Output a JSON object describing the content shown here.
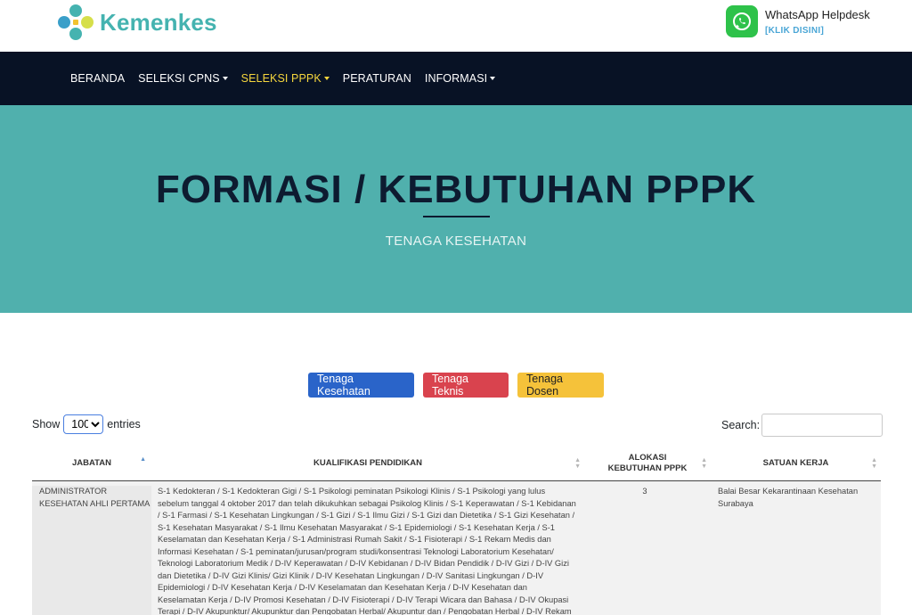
{
  "brand": {
    "name": "Kemenkes",
    "helpdesk_title": "WhatsApp Helpdesk",
    "helpdesk_link": "[KLIK DISINI]",
    "helpdesk_icon": "whatsapp-icon",
    "colors": {
      "brand": "#45b3b0",
      "whatsapp": "#2ec24a"
    }
  },
  "nav": {
    "items": [
      {
        "label": "BERANDA",
        "dropdown": false,
        "active": false
      },
      {
        "label": "SELEKSI CPNS",
        "dropdown": true,
        "active": false
      },
      {
        "label": "SELEKSI PPPK",
        "dropdown": true,
        "active": true
      },
      {
        "label": "PERATURAN",
        "dropdown": false,
        "active": false
      },
      {
        "label": "INFORMASI",
        "dropdown": true,
        "active": false
      }
    ],
    "colors": {
      "background": "#081225",
      "active": "#f5d63d"
    }
  },
  "hero": {
    "title": "FORMASI / KEBUTUHAN PPPK",
    "subtitle": "TENAGA KESEHATAN",
    "colors": {
      "background": "#50b0ad"
    }
  },
  "categories": [
    {
      "label": "Tenaga Kesehatan",
      "color": "#2a64c9"
    },
    {
      "label": "Tenaga Teknis",
      "color": "#d9434e"
    },
    {
      "label": "Tenaga Dosen",
      "color": "#f5c23a"
    }
  ],
  "table_controls": {
    "show_label": "Show",
    "entries_value": "100",
    "entries_label": "entries",
    "search_label": "Search:",
    "search_value": ""
  },
  "table": {
    "columns": [
      "JABATAN",
      "KUALIFIKASI PENDIDIKAN",
      "ALOKASI KEBUTUHAN PPPK",
      "SATUAN KERJA"
    ],
    "rows": [
      {
        "jabatan": "ADMINISTRATOR KESEHATAN AHLI PERTAMA",
        "kualifikasi": "S-1 Kedokteran / S-1 Kedokteran Gigi / S-1 Psikologi peminatan Psikologi Klinis / S-1 Psikologi yang lulus sebelum tanggal 4 oktober 2017 dan telah dikukuhkan sebagai Psikolog Klinis / S-1 Keperawatan / S-1 Kebidanan / S-1 Farmasi / S-1 Kesehatan Lingkungan / S-1 Gizi / S-1 Ilmu Gizi / S-1 Gizi dan Dietetika / S-1 Gizi Kesehatan / S-1 Kesehatan Masyarakat / S-1 Ilmu Kesehatan Masyarakat / S-1 Epidemiologi / S-1 Kesehatan Kerja / S-1 Keselamatan dan Kesehatan Kerja / S-1 Administrasi Rumah Sakit / S-1 Fisioterapi / S-1 Rekam Medis dan Informasi Kesehatan / S-1 peminatan/jurusan/program studi/konsentrasi Teknologi Laboratorium Kesehatan/ Teknologi Laboratorium Medik / D-IV Keperawatan / D-IV Kebidanan / D-IV Bidan Pendidik / D-IV Gizi / D-IV Gizi dan Dietetika / D-IV Gizi Klinis/ Gizi Klinik / D-IV Kesehatan Lingkungan / D-IV Sanitasi Lingkungan / D-IV Epidemiologi / D-IV Kesehatan Kerja / D-IV Keselamatan dan Kesehatan Kerja / D-IV Kesehatan dan Keselamatan Kerja / D-IV Promosi Kesehatan / D-IV Fisioterapi / D-IV Terapi Wicara dan Bahasa / D-IV Okupasi Terapi / D-IV Akupunktur/ Akupunktur dan Pengobatan Herbal/ Akupuntur dan / Pengobatan Herbal / D-IV Rekam Medis dan Informasi Kesehatan / D-IV Rekam Medis",
        "alokasi": "3",
        "satuan_kerja": "Balai Besar Kekarantinaan Kesehatan Surabaya"
      }
    ]
  }
}
